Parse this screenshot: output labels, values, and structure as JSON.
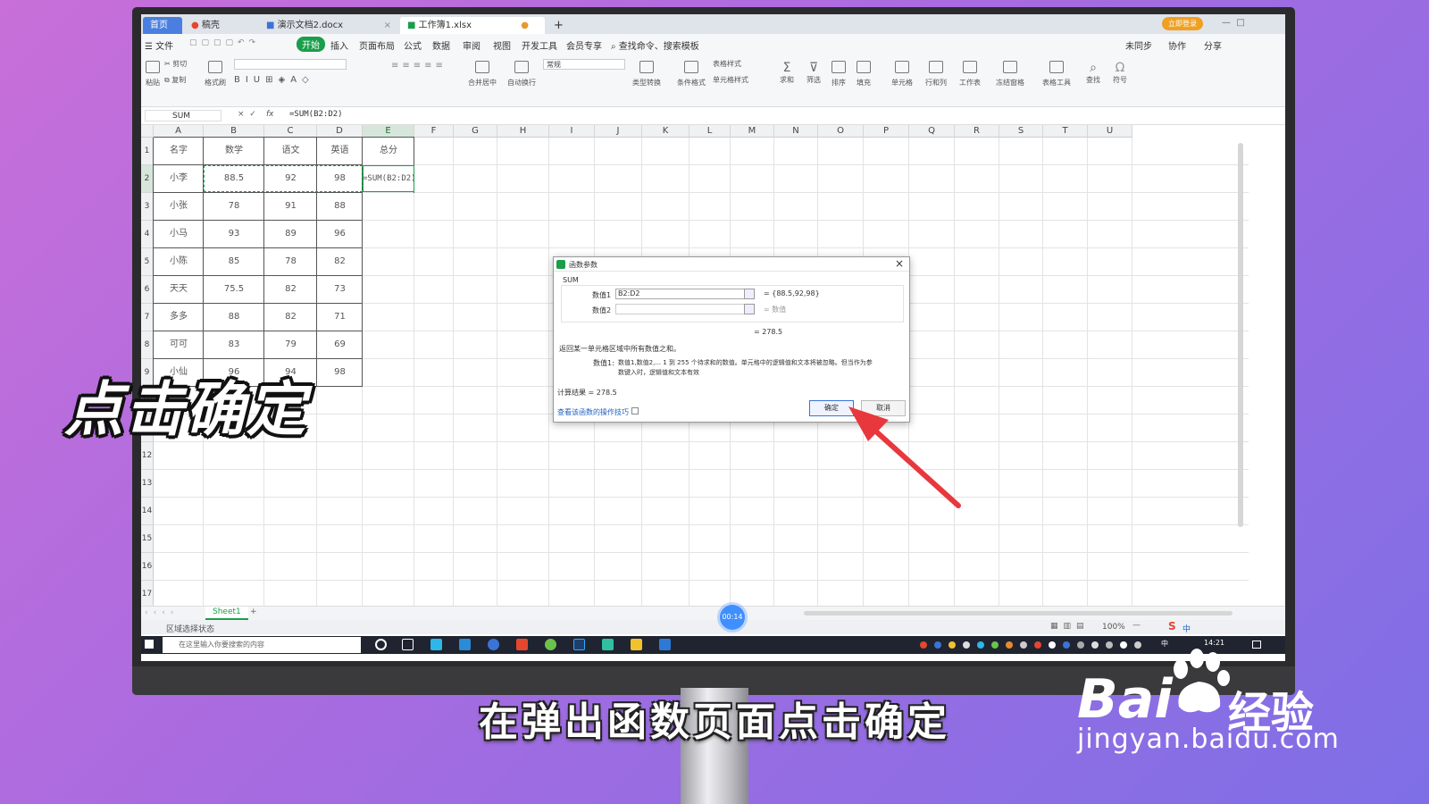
{
  "overlay": {
    "big_caption": "点击确定",
    "subtitle": "在弹出函数页面点击确定",
    "watermark_brand": "Bai",
    "watermark_cn": "经验",
    "watermark_url": "jingyan.baidu.com"
  },
  "tabs": [
    {
      "label": "首页"
    },
    {
      "label": "稿壳"
    },
    {
      "label": "演示文档2.docx"
    },
    {
      "label": "工作簿1.xlsx"
    }
  ],
  "top_right": {
    "badge": "立即登录"
  },
  "menu": {
    "file": "文件",
    "items": [
      "开始",
      "插入",
      "页面布局",
      "公式",
      "数据",
      "审阅",
      "视图",
      "开发工具",
      "会员专享"
    ],
    "search": "查找命令、搜索模板",
    "right": [
      "未同步",
      "协作",
      "分享"
    ]
  },
  "ribbon": {
    "cut": "剪切",
    "paste": "粘贴",
    "copy": "复制",
    "format_painter": "格式刷",
    "merge": "合并居中",
    "wrap": "自动换行",
    "number_format": "常规",
    "type_convert": "类型转换",
    "cond_format": "条件格式",
    "table_style": "表格样式",
    "cell_style": "单元格样式",
    "sum": "求和",
    "filter": "筛选",
    "sort": "排序",
    "fill": "填充",
    "cell": "单元格",
    "rowcol": "行和列",
    "worksheet": "工作表",
    "freeze": "冻结窗格",
    "tools": "表格工具",
    "find": "查找",
    "symbol": "符号"
  },
  "formula_bar": {
    "name_box": "SUM",
    "fx": "fx",
    "formula": "=SUM(B2:D2)"
  },
  "columns": [
    "A",
    "B",
    "C",
    "D",
    "E",
    "F",
    "G",
    "H",
    "I",
    "J",
    "K",
    "L",
    "M",
    "N",
    "O",
    "P",
    "Q",
    "R",
    "S",
    "T",
    "U"
  ],
  "rows": [
    "1",
    "2",
    "3",
    "4",
    "5",
    "6",
    "7",
    "8",
    "9",
    "10",
    "11",
    "12",
    "13",
    "14",
    "15",
    "16",
    "17"
  ],
  "table": {
    "headers": [
      "名字",
      "数学",
      "语文",
      "英语",
      "总分"
    ],
    "rows": [
      [
        "小李",
        "88.5",
        "92",
        "98",
        "=SUM(B2:D2)"
      ],
      [
        "小张",
        "78",
        "91",
        "88",
        ""
      ],
      [
        "小马",
        "93",
        "89",
        "96",
        ""
      ],
      [
        "小陈",
        "85",
        "78",
        "82",
        ""
      ],
      [
        "天天",
        "75.5",
        "82",
        "73",
        ""
      ],
      [
        "多多",
        "88",
        "82",
        "71",
        ""
      ],
      [
        "可可",
        "83",
        "79",
        "69",
        ""
      ],
      [
        "小仙",
        "96",
        "94",
        "98",
        ""
      ]
    ]
  },
  "dialog": {
    "title": "函数参数",
    "func": "SUM",
    "arg1_label": "数值1",
    "arg1_value": "B2:D2",
    "arg1_result": "= {88.5,92,98}",
    "arg2_label": "数值2",
    "arg2_result": "= 数值",
    "total": "= 278.5",
    "desc": "返回某一单元格区域中所有数值之和。",
    "help_label": "数值1:",
    "help_text1": "数值1,数值2,... 1 到 255 个待求和的数值。单元格中的逻辑值和文本将被忽略。但当作为参",
    "help_text2": "数键入时，逻辑值和文本有效",
    "calc_result": "计算结果 = 278.5",
    "tips_link": "查看该函数的操作技巧",
    "ok": "确定",
    "cancel": "取消"
  },
  "sheet": {
    "name": "Sheet1",
    "add": "+"
  },
  "status": {
    "left": "区域选择状态",
    "zoom": "100%"
  },
  "timer": "00:14",
  "taskbar": {
    "search_placeholder": "在这里输入你要搜索的内容",
    "time": "14:21",
    "ime": "中"
  },
  "colors": {
    "accent_green": "#1a9e4b",
    "arrow_red": "#e8383d",
    "link_blue": "#1f5fbf"
  }
}
